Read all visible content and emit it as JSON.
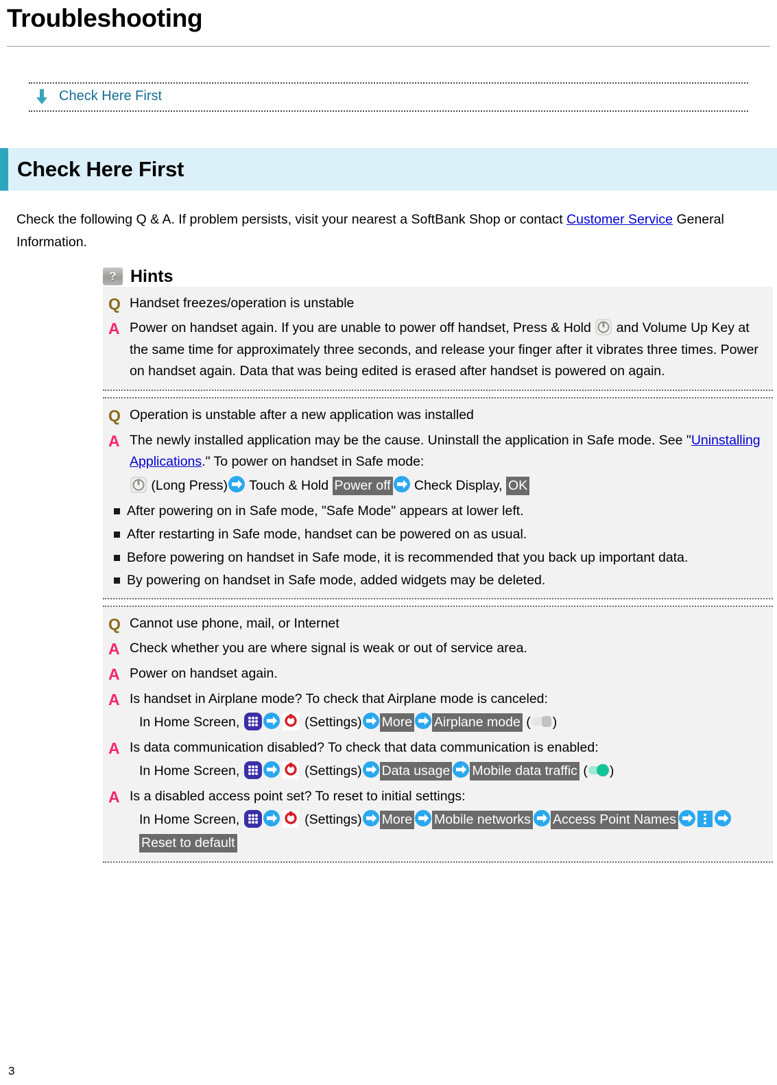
{
  "page": {
    "title": "Troubleshooting",
    "number": "3"
  },
  "toc": {
    "arrow_icon": "down-arrow-icon",
    "link": "Check Here First"
  },
  "section": {
    "title": "Check Here First",
    "accent_color": "#2ba8bf",
    "background_color": "#dcf0fa"
  },
  "intro": {
    "before_link": "Check the following Q & A. If problem persists, visit your nearest a SoftBank Shop or contact ",
    "link": "Customer Service",
    "after_link": " General Information."
  },
  "hints": {
    "icon": "question-mark-icon",
    "label": "Hints"
  },
  "markers": {
    "question": "Q",
    "answer": "A",
    "question_color": "#8a6b1e",
    "answer_color": "#f5256f"
  },
  "qa": [
    {
      "question": "Handset freezes/operation is unstable",
      "answer_part1": "Power on handset again. If you are unable to power off handset, Press & Hold ",
      "answer_icon": "power-key-icon",
      "answer_part2": " and Volume Up Key at the same time for approximately three seconds, and release your finger after it vibrates three times. Power on handset again. Data that was being edited is erased after handset is powered on again."
    },
    {
      "question": "Operation is unstable after a new application was installed",
      "answer_before_link": "The newly installed application may be the cause. Uninstall the application in Safe mode. See \"",
      "answer_link": "Uninstalling Applications",
      "answer_after_link": ".\" To power on handset in Safe mode:",
      "steps": [
        {
          "type": "icon",
          "icon": "power-key-icon"
        },
        {
          "type": "plain",
          "label": " (Long Press)"
        },
        {
          "type": "icon",
          "icon": "blue-right-arrow-icon"
        },
        {
          "type": "plain",
          "label": " Touch & Hold "
        },
        {
          "type": "chip",
          "label": "Power off"
        },
        {
          "type": "icon",
          "icon": "blue-right-arrow-icon"
        },
        {
          "type": "plain",
          "label": " Check Display, "
        },
        {
          "type": "chip",
          "label": "OK"
        }
      ],
      "notes": [
        "After powering on in Safe mode, \"Safe Mode\" appears at lower left.",
        "After restarting in Safe mode, handset can be powered on as usual.",
        "Before powering on handset in Safe mode, it is recommended that you back up important data.",
        "By powering on handset in Safe mode, added widgets may be deleted."
      ]
    },
    {
      "question": "Cannot use phone, mail, or Internet",
      "answers": [
        {
          "text": "Check whether you are where signal is weak or out of service area."
        },
        {
          "text": "Power on handset again."
        },
        {
          "text": "Is handset in Airplane mode? To check that Airplane mode is canceled:",
          "steps": [
            {
              "type": "plain",
              "label": "In Home Screen, "
            },
            {
              "type": "icon",
              "icon": "app-drawer-icon"
            },
            {
              "type": "icon",
              "icon": "blue-right-arrow-icon"
            },
            {
              "type": "icon",
              "icon": "settings-gear-icon"
            },
            {
              "type": "plain",
              "label": " (Settings)"
            },
            {
              "type": "icon",
              "icon": "blue-right-arrow-icon"
            },
            {
              "type": "chip",
              "label": "More"
            },
            {
              "type": "icon",
              "icon": "blue-right-arrow-icon"
            },
            {
              "type": "chip",
              "label": "Airplane mode"
            },
            {
              "type": "plain",
              "label": " ("
            },
            {
              "type": "icon",
              "icon": "toggle-off-icon"
            },
            {
              "type": "plain",
              "label": ")"
            }
          ]
        },
        {
          "text": "Is data communication disabled? To check that data communication is enabled:",
          "steps": [
            {
              "type": "plain",
              "label": "In Home Screen, "
            },
            {
              "type": "icon",
              "icon": "app-drawer-icon"
            },
            {
              "type": "icon",
              "icon": "blue-right-arrow-icon"
            },
            {
              "type": "icon",
              "icon": "settings-gear-icon"
            },
            {
              "type": "plain",
              "label": " (Settings)"
            },
            {
              "type": "icon",
              "icon": "blue-right-arrow-icon"
            },
            {
              "type": "chip",
              "label": "Data usage"
            },
            {
              "type": "icon",
              "icon": "blue-right-arrow-icon"
            },
            {
              "type": "chip",
              "label": "Mobile data traffic"
            },
            {
              "type": "plain",
              "label": " ("
            },
            {
              "type": "icon",
              "icon": "toggle-on-icon"
            },
            {
              "type": "plain",
              "label": ")"
            }
          ]
        },
        {
          "text": "Is a disabled access point set? To reset to initial settings:",
          "steps": [
            {
              "type": "plain",
              "label": "In Home Screen, "
            },
            {
              "type": "icon",
              "icon": "app-drawer-icon"
            },
            {
              "type": "icon",
              "icon": "blue-right-arrow-icon"
            },
            {
              "type": "icon",
              "icon": "settings-gear-icon"
            },
            {
              "type": "plain",
              "label": " (Settings)"
            },
            {
              "type": "icon",
              "icon": "blue-right-arrow-icon"
            },
            {
              "type": "chip",
              "label": "More"
            },
            {
              "type": "icon",
              "icon": "blue-right-arrow-icon"
            },
            {
              "type": "chip",
              "label": "Mobile networks"
            },
            {
              "type": "icon",
              "icon": "blue-right-arrow-icon"
            },
            {
              "type": "chip",
              "label": "Access Point Names"
            },
            {
              "type": "icon",
              "icon": "blue-right-arrow-icon"
            },
            {
              "type": "icon",
              "icon": "overflow-menu-icon"
            },
            {
              "type": "icon",
              "icon": "blue-right-arrow-icon"
            },
            {
              "type": "chip",
              "label": "Reset to default"
            }
          ]
        }
      ]
    }
  ]
}
